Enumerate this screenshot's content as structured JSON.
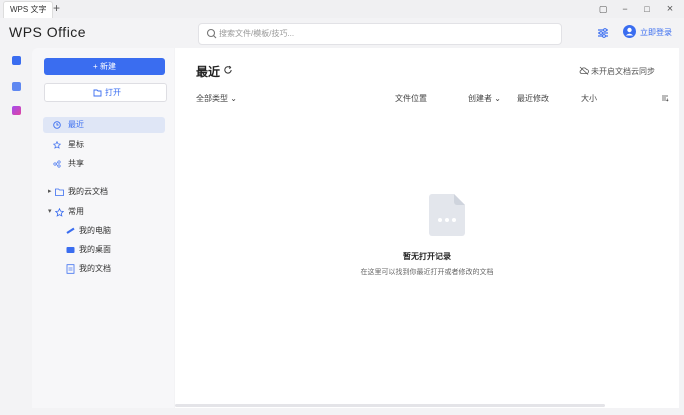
{
  "titlebar": {
    "tab_label": "WPS 文字",
    "new_tab": "+",
    "controls": {
      "pin": "▢",
      "minimize": "−",
      "maximize": "□",
      "close": "×"
    }
  },
  "header": {
    "logo": "WPS Office",
    "search_placeholder": "搜索文件/模板/技巧...",
    "login_label": "立即登录"
  },
  "sidebar": {
    "new_label": "+ 新建",
    "open_label": "打开",
    "nav": [
      "最近",
      "星标",
      "共享"
    ],
    "tree": [
      {
        "label": "我的云文档",
        "arrow": "▸"
      },
      {
        "label": "常用",
        "arrow": "▾"
      }
    ],
    "common_items": [
      "我的电脑",
      "我的桌面",
      "我的文档"
    ]
  },
  "main": {
    "title": "最近",
    "cloud_sync": "未开启文档云同步",
    "columns": {
      "type": "全部类型 ⌄",
      "location": "文件位置",
      "creator": "创建者 ⌄",
      "modified": "最近修改",
      "size": "大小"
    },
    "empty_title": "暂无打开记录",
    "empty_sub": "在这里可以找到你最近打开或者修改的文档"
  },
  "colors": {
    "accent": "#3a6df0",
    "background": "#f3f3f5",
    "sidebar_active": "#dfe6f6"
  }
}
